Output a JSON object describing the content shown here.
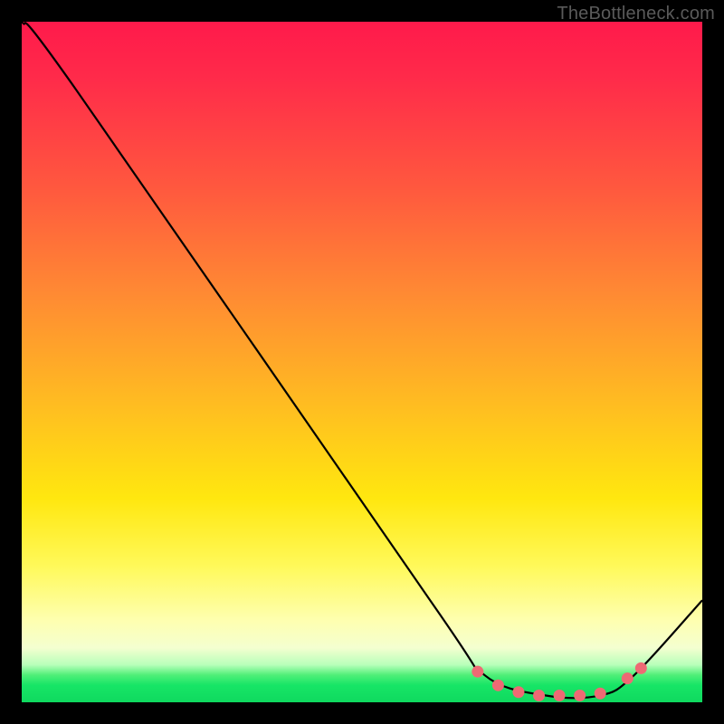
{
  "watermark": "TheBottleneck.com",
  "colors": {
    "line": "#000000",
    "marker_fill": "#ee6a74",
    "marker_stroke": "#d94f5e"
  },
  "chart_data": {
    "type": "line",
    "title": "",
    "xlabel": "",
    "ylabel": "",
    "xlim": [
      0,
      100
    ],
    "ylim": [
      0,
      100
    ],
    "series": [
      {
        "name": "curve",
        "x": [
          0,
          8,
          60,
          68,
          77,
          85,
          90,
          100
        ],
        "y": [
          100,
          90,
          15,
          4,
          1,
          1,
          4,
          15
        ]
      }
    ],
    "markers": {
      "name": "highlight",
      "x": [
        67,
        70,
        73,
        76,
        79,
        82,
        85,
        89,
        91
      ],
      "y": [
        4.5,
        2.5,
        1.5,
        1.0,
        1.0,
        1.0,
        1.3,
        3.5,
        5.0
      ]
    }
  }
}
